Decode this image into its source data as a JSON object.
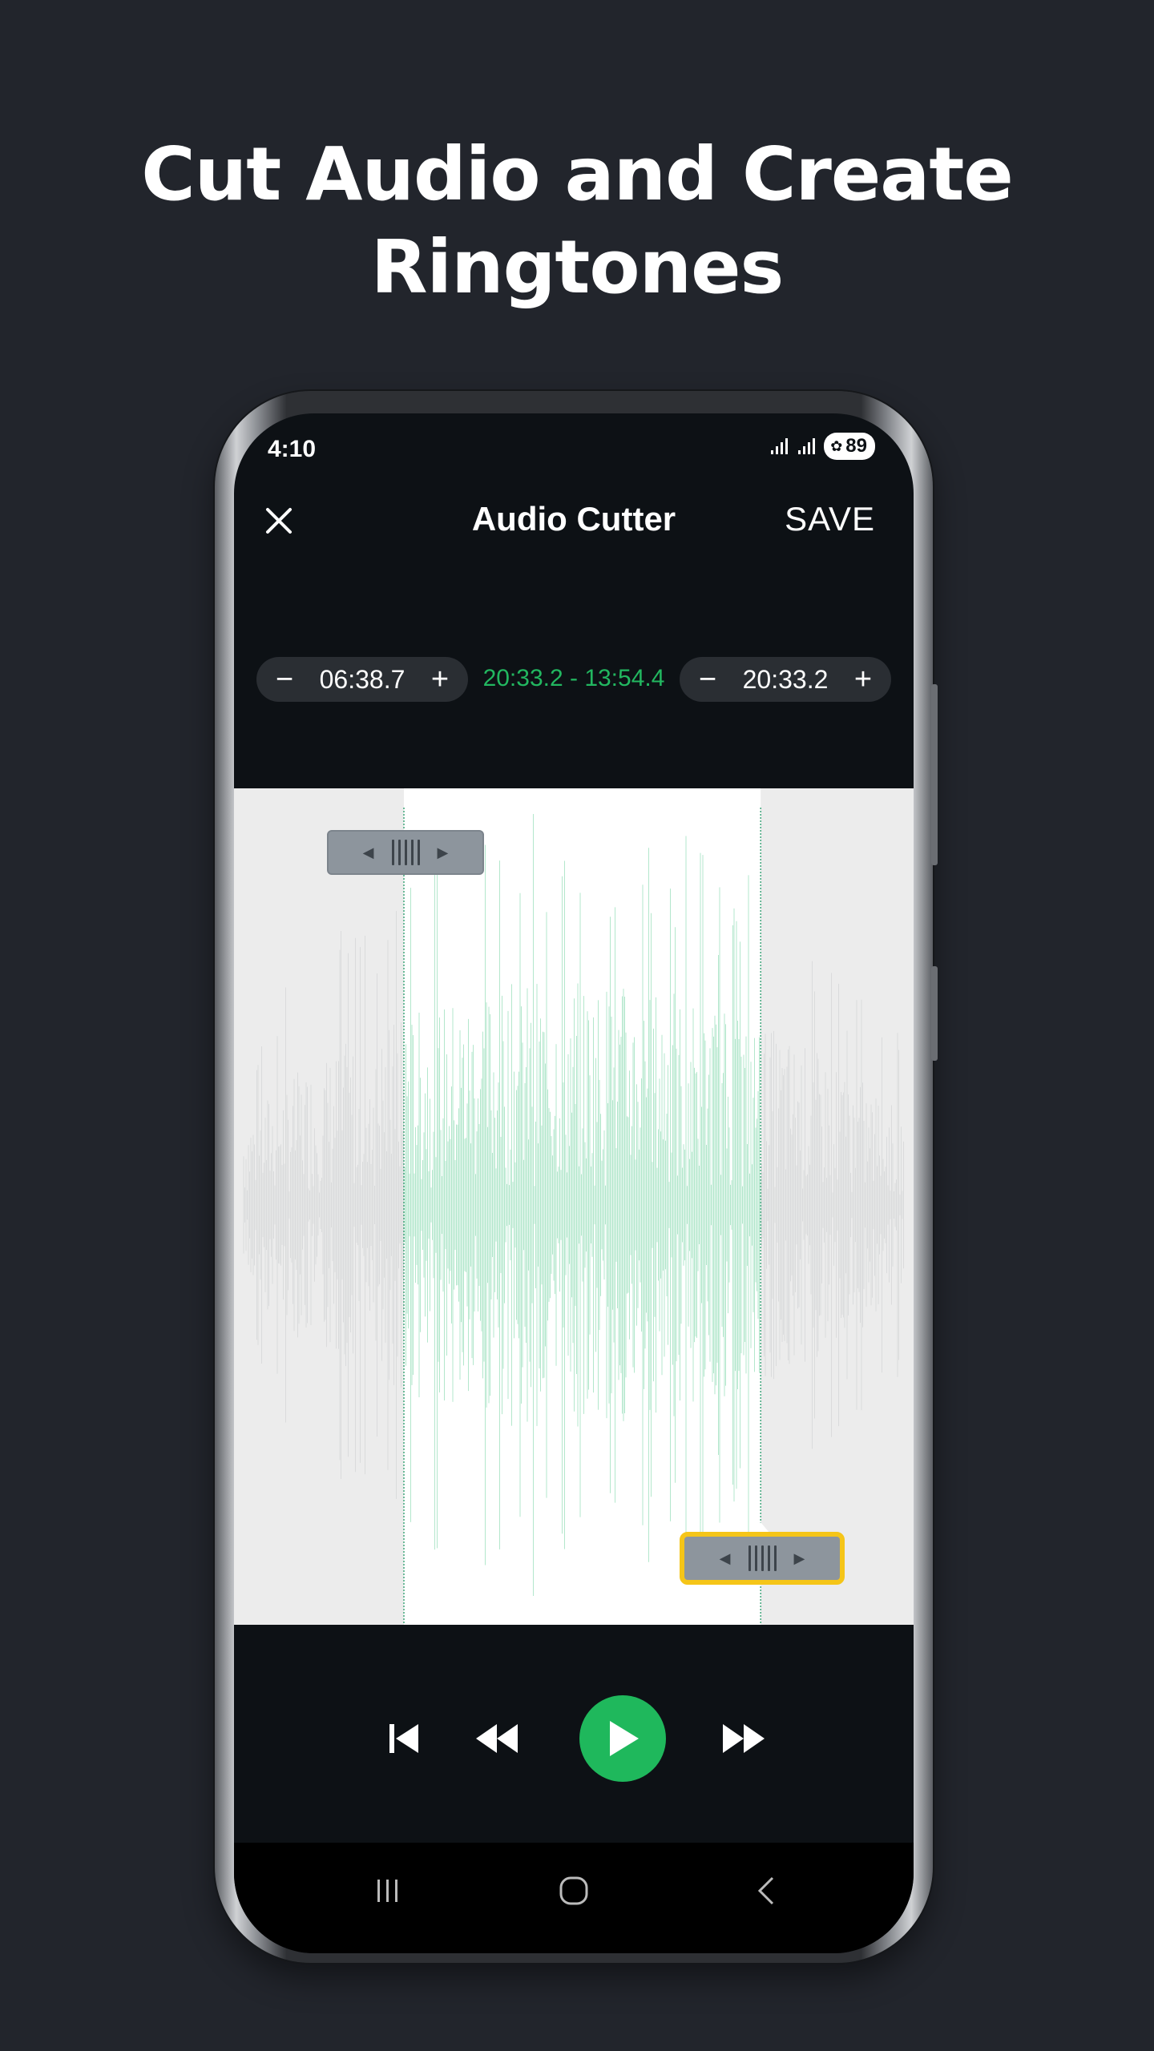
{
  "headline": {
    "line1": "Cut Audio and Create",
    "line2": "Ringtones"
  },
  "status_bar": {
    "time": "4:10",
    "battery": "89",
    "icons": [
      "signal-icon",
      "signal-icon",
      "battery-saver-icon"
    ]
  },
  "app_bar": {
    "close_icon": "close-icon",
    "title": "Audio Cutter",
    "save_label": "SAVE"
  },
  "trim": {
    "start_value": "06:38.7",
    "end_value": "20:33.2",
    "range_text": "20:33.2 - 13:54.4",
    "minus_label": "−",
    "plus_label": "+"
  },
  "waveform": {
    "selection_start_fraction": 0.25,
    "selection_end_fraction": 0.775,
    "selected_color": "#a6e3c3",
    "unselected_color": "#d3d4d6",
    "trimmed_background": "#ececec",
    "active_handle": "end",
    "active_handle_color": "#f5c518"
  },
  "transport": {
    "icons": [
      "skip-to-start-icon",
      "rewind-icon",
      "play-icon",
      "fast-forward-icon"
    ],
    "accent": "#1fb85c"
  },
  "navbar": {
    "icons": [
      "recent-apps-icon",
      "home-icon",
      "back-icon"
    ]
  }
}
